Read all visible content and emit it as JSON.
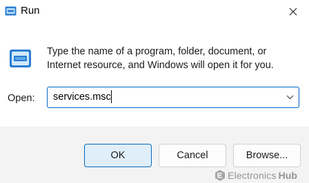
{
  "window": {
    "title": "Run",
    "icon": "run-icon",
    "close_icon": "close-icon"
  },
  "dialog": {
    "description": "Type the name of a program, folder, document, or Internet resource, and Windows will open it for you.",
    "open_label": "Open:",
    "open_value": "services.msc",
    "dropdown_icon": "chevron-down-icon"
  },
  "buttons": {
    "ok": "OK",
    "cancel": "Cancel",
    "browse": "Browse..."
  },
  "watermark": {
    "brand_part1": "Electronics",
    "brand_part2": "Hub"
  },
  "colors": {
    "accent": "#0067c0",
    "ok_background": "#e0eef9",
    "footer_background": "#f3f3f3"
  }
}
